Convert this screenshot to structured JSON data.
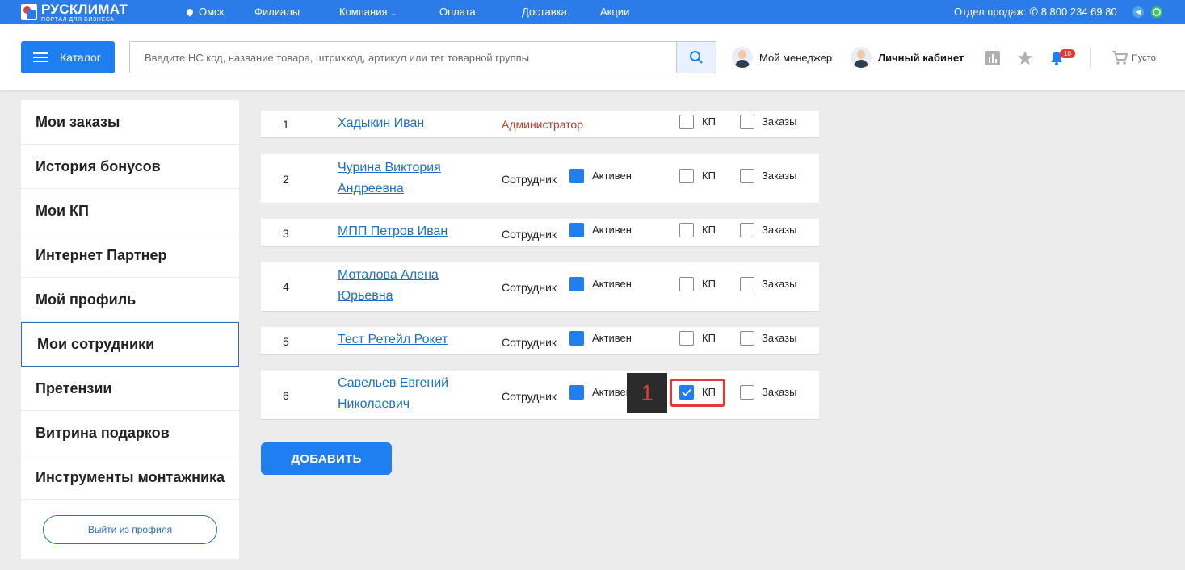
{
  "topbar": {
    "logo_name": "РУСКЛИМАТ",
    "logo_sub": "ПОРТАЛ ДЛЯ БИЗНЕСА",
    "city": "Омск",
    "nav": [
      "Филиалы",
      "Компания",
      "Оплата",
      "Доставка",
      "Акции"
    ],
    "sales_label": "Отдел продаж:",
    "phone": "8 800 234 69 80"
  },
  "header": {
    "catalog_label": "Каталог",
    "search_placeholder": "Введите НС код, название товара, штрихкод, артикул или тег товарной группы",
    "manager_label": "Мой менеджер",
    "cabinet_label": "Личный кабинет",
    "notifications_count": "10",
    "cart_label": "Пусто"
  },
  "sidebar": {
    "items": [
      {
        "label": "Мои заказы",
        "active": false
      },
      {
        "label": "История бонусов",
        "active": false
      },
      {
        "label": "Мои КП",
        "active": false
      },
      {
        "label": "Интернет Партнер",
        "active": false
      },
      {
        "label": "Мой профиль",
        "active": false
      },
      {
        "label": "Мои сотрудники",
        "active": true
      },
      {
        "label": "Претензии",
        "active": false
      },
      {
        "label": "Витрина подарков",
        "active": false
      },
      {
        "label": "Инструменты монтажника",
        "active": false
      }
    ],
    "logout_label": "Выйти из профиля"
  },
  "employees": {
    "active_label": "Активен",
    "kp_label": "КП",
    "orders_label": "Заказы",
    "rows": [
      {
        "num": "1",
        "name": "Хадыкин Иван",
        "role": "Администратор",
        "active": null,
        "kp": false,
        "orders": false
      },
      {
        "num": "2",
        "name": "Чурина Виктория Андреевна",
        "role": "Сотрудник",
        "active": true,
        "kp": false,
        "orders": false
      },
      {
        "num": "3",
        "name": "МПП Петров Иван",
        "role": "Сотрудник",
        "active": true,
        "kp": false,
        "orders": false
      },
      {
        "num": "4",
        "name": "Моталова Алена Юрьевна",
        "role": "Сотрудник",
        "active": true,
        "kp": false,
        "orders": false
      },
      {
        "num": "5",
        "name": "Тест Ретейл Рокет",
        "role": "Сотрудник",
        "active": true,
        "kp": false,
        "orders": false
      },
      {
        "num": "6",
        "name": "Савельев Евгений Николаевич",
        "role": "Сотрудник",
        "active": true,
        "kp": true,
        "orders": false
      }
    ]
  },
  "add_button_label": "ДОБАВИТЬ",
  "annotation": {
    "label": "1",
    "color": "#e53935"
  },
  "colors": {
    "accent": "#1f7ef0",
    "topbar": "#2b7be9",
    "link": "#1a6fc9",
    "admin": "#c0392b"
  }
}
